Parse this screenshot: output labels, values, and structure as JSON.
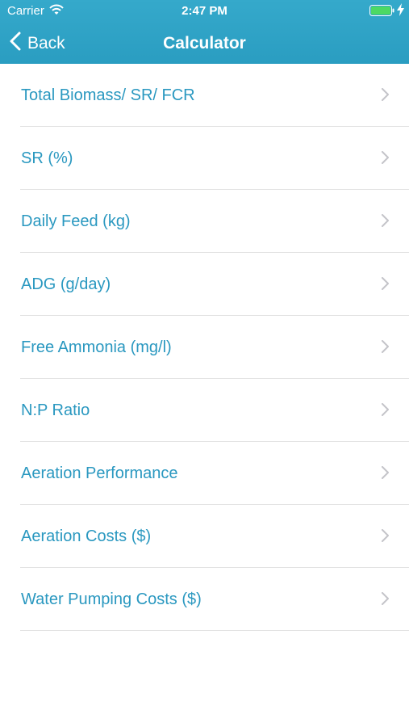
{
  "status_bar": {
    "carrier": "Carrier",
    "time": "2:47 PM"
  },
  "nav": {
    "back_label": "Back",
    "title": "Calculator"
  },
  "colors": {
    "header": "#2fa3c6",
    "accent_text": "#2a98c0",
    "battery": "#4cd964"
  },
  "menu": {
    "items": [
      {
        "label": "Total Biomass/ SR/ FCR"
      },
      {
        "label": "SR (%)"
      },
      {
        "label": "Daily Feed (kg)"
      },
      {
        "label": "ADG (g/day)"
      },
      {
        "label": "Free Ammonia (mg/l)"
      },
      {
        "label": "N:P Ratio"
      },
      {
        "label": "Aeration Performance"
      },
      {
        "label": "Aeration Costs ($)"
      },
      {
        "label": "Water Pumping Costs ($)"
      }
    ]
  }
}
